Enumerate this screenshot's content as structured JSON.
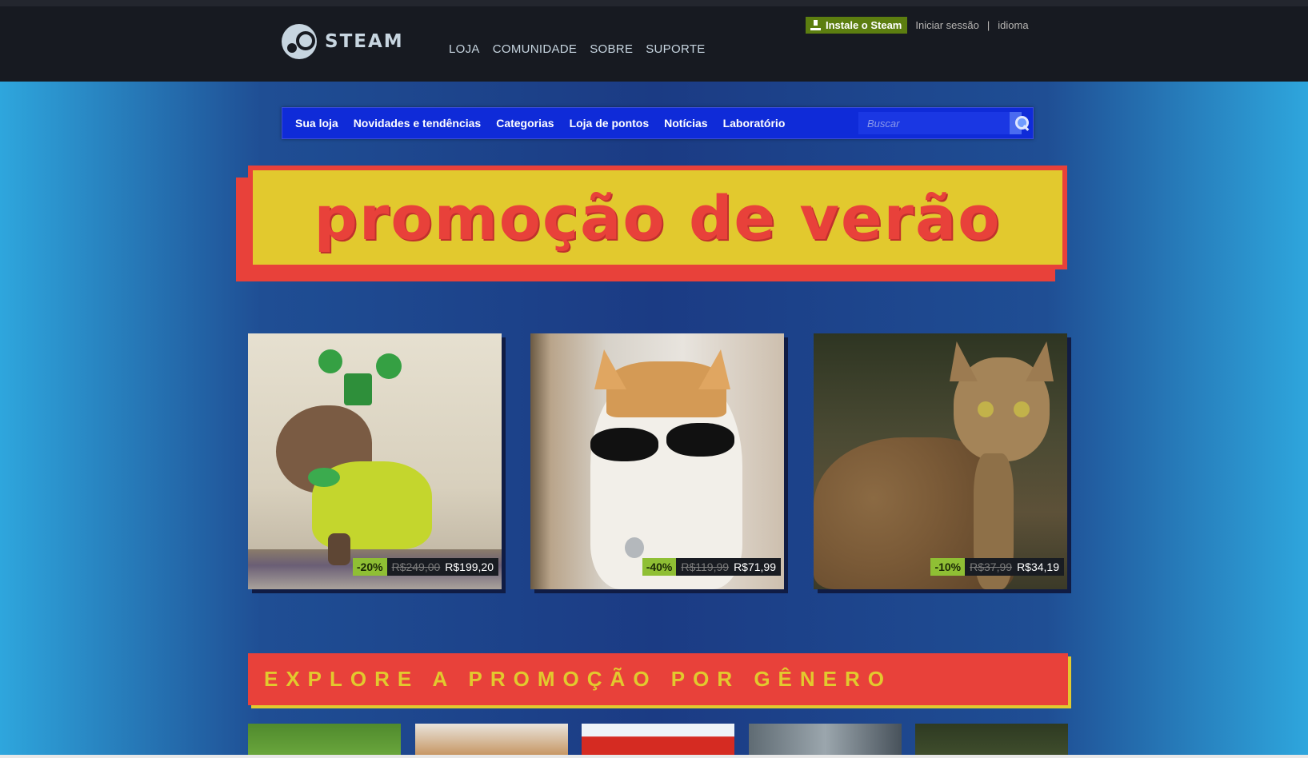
{
  "header": {
    "logo_text": "STEAM",
    "nav": [
      "LOJA",
      "COMUNIDADE",
      "SOBRE",
      "SUPORTE"
    ],
    "install_label": "Instale o Steam",
    "login_label": "Iniciar sessão",
    "separator": "|",
    "language_label": "idioma"
  },
  "store_nav": {
    "items": [
      "Sua loja",
      "Novidades e tendências",
      "Categorias",
      "Loja de pontos",
      "Notícias",
      "Laboratório"
    ],
    "search_placeholder": "Buscar"
  },
  "banner": {
    "title": "promoção de verão"
  },
  "products": [
    {
      "discount": "-20%",
      "original_price": "R$249,00",
      "final_price": "R$199,20"
    },
    {
      "discount": "-40%",
      "original_price": "R$119,99",
      "final_price": "R$71,99"
    },
    {
      "discount": "-10%",
      "original_price": "R$37,99",
      "final_price": "R$34,19"
    }
  ],
  "genre_section": {
    "title": "EXPLORE A PROMOÇÃO POR GÊNERO"
  },
  "colors": {
    "sale_red": "#e8413a",
    "sale_yellow": "#e2c92e",
    "discount_green": "#8fbf34",
    "store_nav_blue": "#0f2bd8",
    "header_dark": "#171a21",
    "install_green": "#5c7e10"
  }
}
